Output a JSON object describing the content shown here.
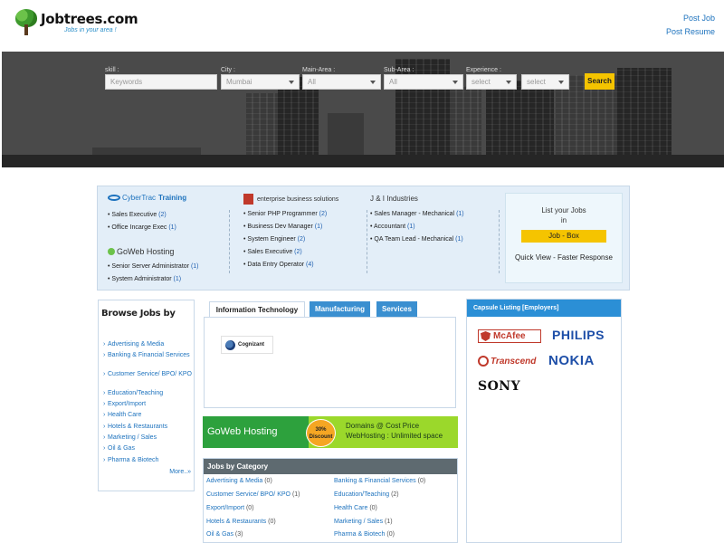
{
  "header": {
    "logo_title": "Jobtrees.com",
    "logo_tagline": "Jobs in your area !",
    "links": [
      "Post Job",
      "Post Resume"
    ]
  },
  "search": {
    "fields": [
      {
        "label": "skill :",
        "value": "Keywords",
        "type": "input"
      },
      {
        "label": "City :",
        "value": "Mumbai",
        "type": "select"
      },
      {
        "label": "Main-Area :",
        "value": "All",
        "type": "select"
      },
      {
        "label": "Sub-Area :",
        "value": "All",
        "type": "select"
      },
      {
        "label": "Experience :",
        "value": "select",
        "type": "select"
      },
      {
        "label": "",
        "value": "select",
        "type": "select"
      }
    ],
    "button": "Search"
  },
  "featured": {
    "employers": [
      {
        "logo_text_1": "CyberTrac",
        "logo_text_2": "Training",
        "icon": "cybertrac-logo",
        "jobs": [
          {
            "title": "Sales Executive",
            "count": "(2)"
          },
          {
            "title": "Office Incarge Exec",
            "count": "(1)"
          }
        ]
      },
      {
        "logo_text_1": "GoWeb Hosting",
        "icon": "goweb-logo",
        "jobs": [
          {
            "title": "Senior Server Administrator",
            "count": "(1)"
          },
          {
            "title": "System Administrator",
            "count": "(1)"
          }
        ]
      },
      {
        "logo_text_1": "enterprise business solutions",
        "icon": "ebs-logo",
        "jobs": [
          {
            "title": "Senior PHP Programmer",
            "count": "(2)"
          },
          {
            "title": "Business Dev Manager",
            "count": "(1)"
          },
          {
            "title": "System Engineer",
            "count": "(2)"
          },
          {
            "title": "Sales Executive",
            "count": "(2)"
          },
          {
            "title": "Data Entry Operator",
            "count": "(4)"
          }
        ]
      },
      {
        "logo_text_1": "J & I Industries",
        "icon": "ji-logo",
        "jobs": [
          {
            "title": "Sales Manager - Mechanical",
            "count": "(1)"
          },
          {
            "title": "Accountant",
            "count": "(1)"
          },
          {
            "title": "QA Team Lead - Mechanical",
            "count": "(1)"
          }
        ]
      }
    ],
    "list_jobs": {
      "title_line1": "List your Jobs",
      "title_line2": "in",
      "button": "Job - Box",
      "subtitle": "Quick View - Faster Response"
    }
  },
  "browse": {
    "title": "Browse Jobs by",
    "items": [
      "Advertising & Media",
      "Banking & Financial Services",
      "Customer Service/ BPO/ KPO",
      "Education/Teaching",
      "Export/Import",
      "Health Care",
      "Hotels & Restaurants",
      "Marketing / Sales",
      "Oil & Gas",
      "Pharma & Biotech"
    ],
    "more": "More..»"
  },
  "tabs": {
    "items": [
      "Information Technology",
      "Manufacturing",
      "Services"
    ],
    "active": "Information Technology",
    "company": "Cognizant"
  },
  "banner": {
    "brand": "GoWeb Hosting",
    "badge_1": "30%",
    "badge_2": "Discount",
    "line1": "Domains @ Cost Price",
    "line2": "WebHosting : Unlimited space"
  },
  "categories": {
    "title": "Jobs by Category",
    "items": [
      {
        "name": "Advertising & Media",
        "count": "(0)"
      },
      {
        "name": "Banking & Financial Services",
        "count": "(0)"
      },
      {
        "name": "Customer Service/ BPO/ KPO",
        "count": "(1)"
      },
      {
        "name": "Education/Teaching",
        "count": "(2)"
      },
      {
        "name": "Export/Import",
        "count": "(0)"
      },
      {
        "name": "Health Care",
        "count": "(0)"
      },
      {
        "name": "Hotels & Restaurants",
        "count": "(0)"
      },
      {
        "name": "Marketing / Sales",
        "count": "(1)"
      },
      {
        "name": "Oil & Gas",
        "count": "(3)"
      },
      {
        "name": "Pharma & Biotech",
        "count": "(0)"
      }
    ]
  },
  "capsule": {
    "title": "Capsule Listing [Employers]",
    "brands": [
      "McAfee",
      "PHILIPS",
      "Transcend",
      "NOKIA",
      "SONY"
    ]
  },
  "colors": {
    "accent": "#2b8fd6",
    "button": "#f5c400",
    "link": "#1e73be"
  }
}
